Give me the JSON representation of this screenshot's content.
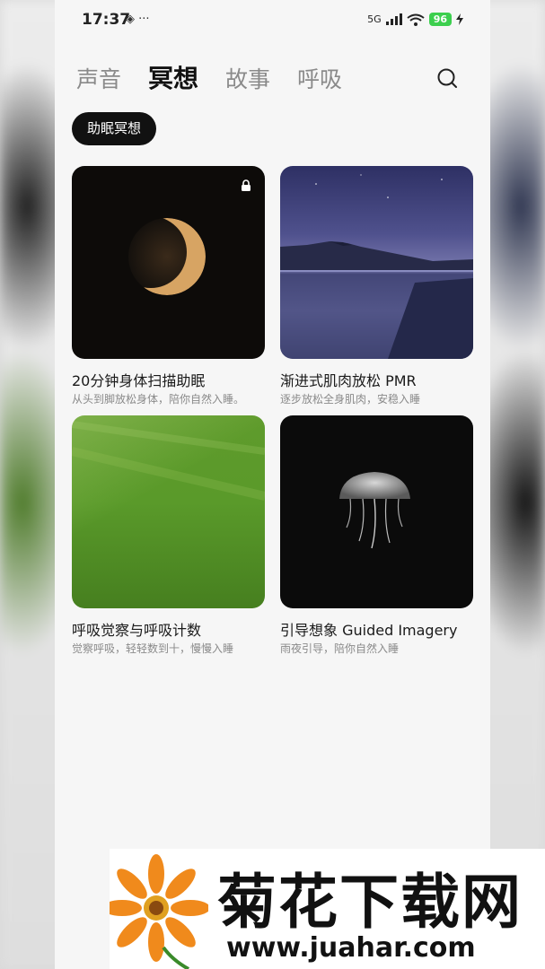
{
  "status_bar": {
    "time": "17:37",
    "extra_icons": "◈ ···",
    "network": "5G",
    "battery": "96"
  },
  "tabs": [
    {
      "label": "声音",
      "active": false
    },
    {
      "label": "冥想",
      "active": true
    },
    {
      "label": "故事",
      "active": false
    },
    {
      "label": "呼吸",
      "active": false
    }
  ],
  "filter_chip": "助眠冥想",
  "cards": [
    {
      "title": "20分钟身体扫描助眠",
      "desc": "从头到脚放松身体，陪你自然入睡。",
      "image": "crescent-moon",
      "locked": true
    },
    {
      "title": "渐进式肌肉放松 PMR",
      "desc": "逐步放松全身肌肉，安稳入睡",
      "image": "mountain-lake-night",
      "locked": false
    },
    {
      "title": "呼吸觉察与呼吸计数",
      "desc": "觉察呼吸，轻轻数到十，慢慢入睡",
      "image": "grass-field",
      "locked": false
    },
    {
      "title": "引导想象 Guided Imagery",
      "desc": "雨夜引导，陪你自然入睡",
      "image": "jellyfish",
      "locked": false
    }
  ],
  "watermark": {
    "title": "菊花下载网",
    "url": "www.juahar.com"
  },
  "colors": {
    "active_tab": "#111111",
    "inactive_tab": "#8a8a8a",
    "chip_bg": "#111111",
    "battery": "#3ccf4e"
  }
}
